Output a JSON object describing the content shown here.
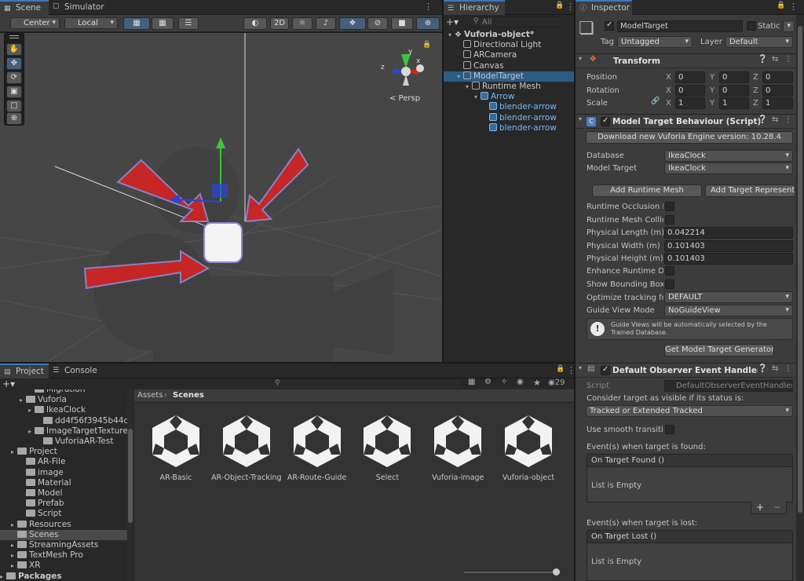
{
  "scene": {
    "tabs": [
      "Scene",
      "Simulator"
    ],
    "toolbar": {
      "pivot": "Center",
      "space": "Local",
      "mode2d": "2D",
      "persp": "< Persp"
    },
    "gizmo_axes": [
      "z",
      "x",
      "y"
    ]
  },
  "hierarchy": {
    "tab": "Hierarchy",
    "search_placeholder": "All",
    "items": [
      {
        "label": "Vuforia-object*",
        "indent": 0,
        "bold": true,
        "selected": false,
        "prefab": false
      },
      {
        "label": "Directional Light",
        "indent": 1,
        "bold": false,
        "selected": false,
        "prefab": false
      },
      {
        "label": "ARCamera",
        "indent": 1,
        "bold": false,
        "selected": false,
        "prefab": false
      },
      {
        "label": "Canvas",
        "indent": 1,
        "bold": false,
        "selected": false,
        "prefab": false
      },
      {
        "label": "ModelTarget",
        "indent": 1,
        "bold": false,
        "selected": true,
        "prefab": false
      },
      {
        "label": "Runtime Mesh",
        "indent": 2,
        "bold": false,
        "selected": false,
        "prefab": false
      },
      {
        "label": "Arrow",
        "indent": 3,
        "bold": false,
        "selected": false,
        "prefab": true
      },
      {
        "label": "blender-arrow",
        "indent": 4,
        "bold": false,
        "selected": false,
        "prefab": true
      },
      {
        "label": "blender-arrow",
        "indent": 4,
        "bold": false,
        "selected": false,
        "prefab": true
      },
      {
        "label": "blender-arrow",
        "indent": 4,
        "bold": false,
        "selected": false,
        "prefab": true
      }
    ]
  },
  "inspector": {
    "tab": "Inspector",
    "object_name": "ModelTarget",
    "static_label": "Static",
    "tag_label": "Tag",
    "tag_value": "Untagged",
    "layer_label": "Layer",
    "layer_value": "Default",
    "transform": {
      "title": "Transform",
      "rows": [
        {
          "label": "Position",
          "x": "0",
          "y": "0",
          "z": "0"
        },
        {
          "label": "Rotation",
          "x": "0",
          "y": "0",
          "z": "0"
        },
        {
          "label": "Scale",
          "x": "1",
          "y": "1",
          "z": "1"
        }
      ],
      "axis": {
        "x": "X",
        "y": "Y",
        "z": "Z"
      }
    },
    "mtb": {
      "title": "Model Target Behaviour (Script)",
      "download_btn": "Download new Vuforia Engine version: 10.28.4",
      "database_label": "Database",
      "database_value": "IkeaClock",
      "model_target_label": "Model Target",
      "model_target_value": "IkeaClock",
      "add_runtime_mesh": "Add Runtime Mesh",
      "add_target_rep": "Add Target Representation",
      "checks": [
        {
          "label": "Runtime Occlusion Mesh",
          "checked": false
        },
        {
          "label": "Runtime Mesh Collider",
          "checked": false
        }
      ],
      "dims": [
        {
          "label": "Physical Length (m)",
          "value": "0.042214"
        },
        {
          "label": "Physical Width (m)",
          "value": "0.101403"
        },
        {
          "label": "Physical Height (m)",
          "value": "0.101403"
        }
      ],
      "enhance_label": "Enhance Runtime Detection",
      "bbox_label": "Show Bounding Box",
      "optimize_label": "Optimize tracking for",
      "optimize_value": "DEFAULT",
      "guide_label": "Guide View Mode",
      "guide_value": "NoGuideView",
      "info": "Guide Views will be automatically selected by the Trained Database.",
      "generator_btn": "Get Model Target Generator"
    },
    "observer": {
      "title": "Default Observer Event Handler (Script)",
      "script_label": "Script",
      "script_value": "DefaultObserverEventHandler",
      "consider_label": "Consider target as visible if its status is:",
      "consider_value": "Tracked or Extended Tracked",
      "smooth_label": "Use smooth transition",
      "found_label": "Event(s) when target is found:",
      "found_header": "On Target Found ()",
      "found_empty": "List is Empty",
      "lost_label": "Event(s) when target is lost:",
      "lost_header": "On Target Lost ()",
      "lost_empty": "List is Empty"
    }
  },
  "project": {
    "tabs": [
      "Project",
      "Console"
    ],
    "count": "29",
    "tree": [
      {
        "label": "Migration",
        "indent": 2,
        "arrow": false,
        "selected": false
      },
      {
        "label": "Vuforia",
        "indent": 1,
        "arrow": true,
        "selected": false
      },
      {
        "label": "IkeaClock",
        "indent": 2,
        "arrow": true,
        "selected": false
      },
      {
        "label": "dd4f56f3945b44c",
        "indent": 3,
        "arrow": false,
        "selected": false
      },
      {
        "label": "ImageTargetTextures",
        "indent": 2,
        "arrow": true,
        "selected": false
      },
      {
        "label": "VuforiaAR-Test",
        "indent": 3,
        "arrow": false,
        "selected": false
      },
      {
        "label": "Project",
        "indent": 0,
        "arrow": true,
        "selected": false
      },
      {
        "label": "AR-File",
        "indent": 1,
        "arrow": false,
        "selected": false
      },
      {
        "label": "image",
        "indent": 1,
        "arrow": false,
        "selected": false
      },
      {
        "label": "Material",
        "indent": 1,
        "arrow": false,
        "selected": false
      },
      {
        "label": "Model",
        "indent": 1,
        "arrow": false,
        "selected": false
      },
      {
        "label": "Prefab",
        "indent": 1,
        "arrow": false,
        "selected": false
      },
      {
        "label": "Script",
        "indent": 1,
        "arrow": false,
        "selected": false
      },
      {
        "label": "Resources",
        "indent": 0,
        "arrow": true,
        "selected": false
      },
      {
        "label": "Scenes",
        "indent": 0,
        "arrow": false,
        "selected": true
      },
      {
        "label": "StreamingAssets",
        "indent": 0,
        "arrow": true,
        "selected": false
      },
      {
        "label": "TextMesh Pro",
        "indent": 0,
        "arrow": true,
        "selected": false
      },
      {
        "label": "XR",
        "indent": 0,
        "arrow": true,
        "selected": false
      },
      {
        "label": "Packages",
        "indent": -1,
        "arrow": true,
        "selected": false
      }
    ],
    "breadcrumb": [
      "Assets",
      "Scenes"
    ],
    "assets": [
      "AR-Basic",
      "AR-Object-Tracking",
      "AR-Route-Guide",
      "Select",
      "Vuforia-image",
      "Vuforia-object"
    ]
  },
  "colors": {
    "accent": "#3a79bb",
    "selected": "#2c5d87",
    "arrow_red": "#d42323"
  }
}
